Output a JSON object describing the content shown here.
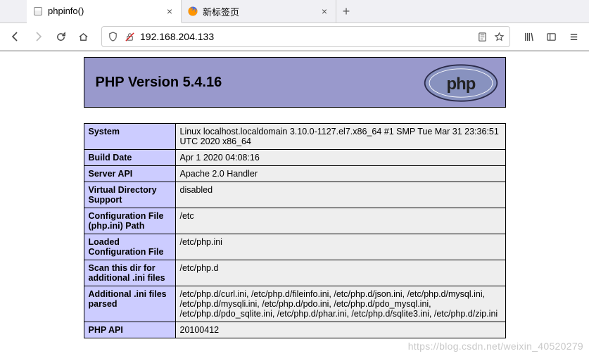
{
  "tabs": [
    {
      "title": "phpinfo()",
      "active": true
    },
    {
      "title": "新标签页",
      "active": false
    }
  ],
  "url": "192.168.204.133",
  "php_header": "PHP Version 5.4.16",
  "rows": [
    {
      "key": "System",
      "val": "Linux localhost.localdomain 3.10.0-1127.el7.x86_64 #1 SMP Tue Mar 31 23:36:51 UTC 2020 x86_64"
    },
    {
      "key": "Build Date",
      "val": "Apr 1 2020 04:08:16"
    },
    {
      "key": "Server API",
      "val": "Apache 2.0 Handler"
    },
    {
      "key": "Virtual Directory Support",
      "val": "disabled"
    },
    {
      "key": "Configuration File (php.ini) Path",
      "val": "/etc"
    },
    {
      "key": "Loaded Configuration File",
      "val": "/etc/php.ini"
    },
    {
      "key": "Scan this dir for additional .ini files",
      "val": "/etc/php.d"
    },
    {
      "key": "Additional .ini files parsed",
      "val": "/etc/php.d/curl.ini, /etc/php.d/fileinfo.ini, /etc/php.d/json.ini, /etc/php.d/mysql.ini, /etc/php.d/mysqli.ini, /etc/php.d/pdo.ini, /etc/php.d/pdo_mysql.ini, /etc/php.d/pdo_sqlite.ini, /etc/php.d/phar.ini, /etc/php.d/sqlite3.ini, /etc/php.d/zip.ini"
    },
    {
      "key": "PHP API",
      "val": "20100412"
    }
  ],
  "watermark": "https://blog.csdn.net/weixin_40520279"
}
